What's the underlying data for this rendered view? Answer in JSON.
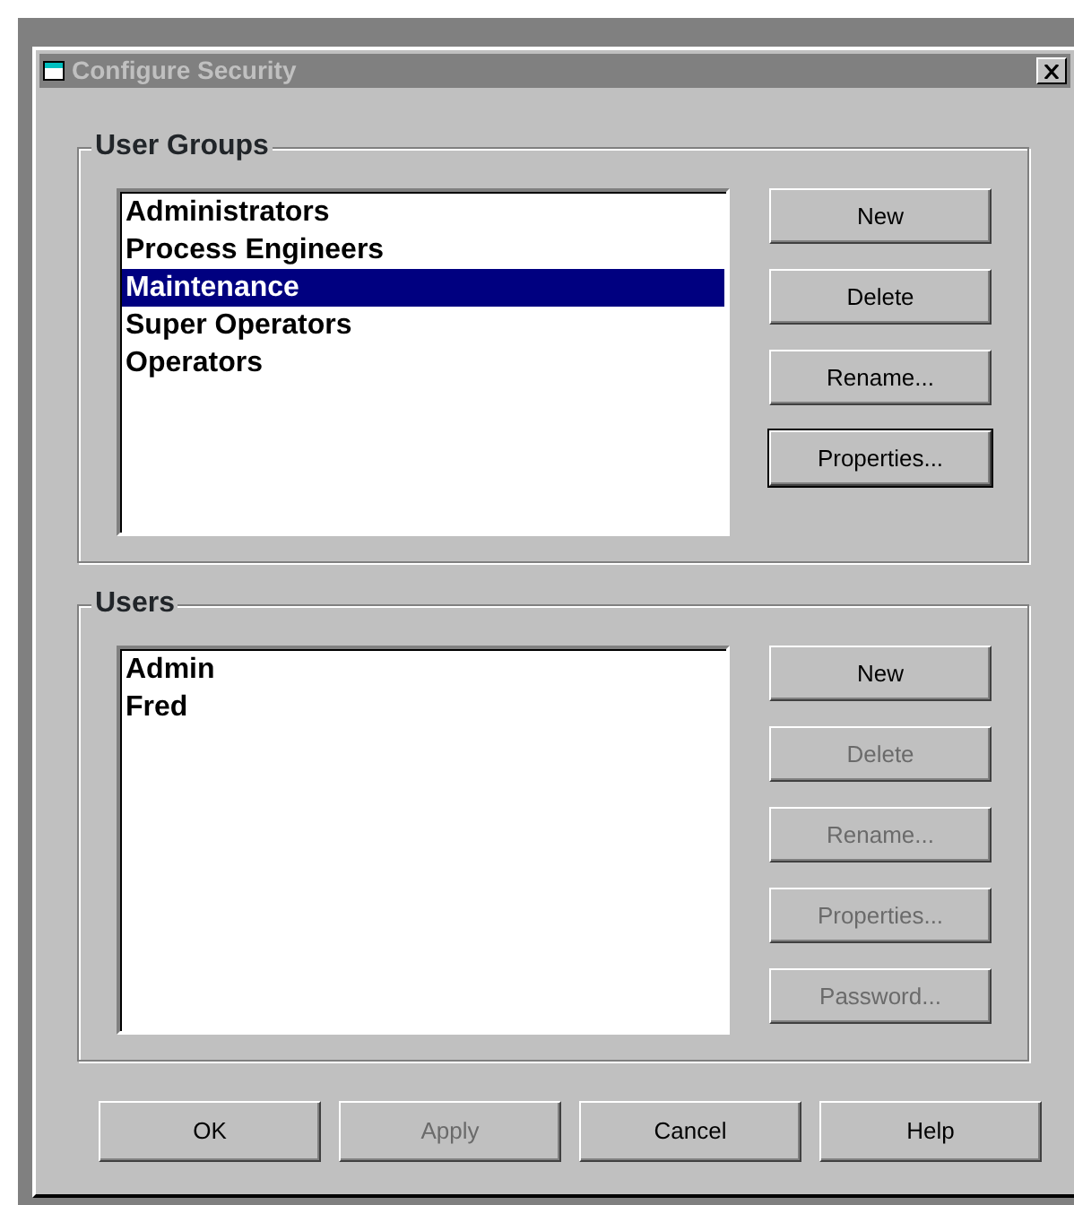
{
  "window": {
    "title": "Configure Security"
  },
  "groups": [
    {
      "title": "User Groups",
      "items": [
        {
          "label": "Administrators",
          "selected": false
        },
        {
          "label": "Process Engineers",
          "selected": false
        },
        {
          "label": "Maintenance",
          "selected": true
        },
        {
          "label": "Super Operators",
          "selected": false
        },
        {
          "label": "Operators",
          "selected": false
        }
      ],
      "buttons": [
        {
          "label": "New",
          "disabled": false,
          "focused": false
        },
        {
          "label": "Delete",
          "disabled": false,
          "focused": false
        },
        {
          "label": "Rename...",
          "disabled": false,
          "focused": false
        },
        {
          "label": "Properties...",
          "disabled": false,
          "focused": true
        }
      ]
    },
    {
      "title": "Users",
      "items": [
        {
          "label": "Admin",
          "selected": false
        },
        {
          "label": "Fred",
          "selected": false
        }
      ],
      "buttons": [
        {
          "label": "New",
          "disabled": false,
          "focused": false
        },
        {
          "label": "Delete",
          "disabled": true,
          "focused": false
        },
        {
          "label": "Rename...",
          "disabled": true,
          "focused": false
        },
        {
          "label": "Properties...",
          "disabled": true,
          "focused": false
        },
        {
          "label": "Password...",
          "disabled": true,
          "focused": false
        }
      ]
    }
  ],
  "footer_buttons": [
    {
      "label": "OK",
      "disabled": false
    },
    {
      "label": "Apply",
      "disabled": true
    },
    {
      "label": "Cancel",
      "disabled": false
    },
    {
      "label": "Help",
      "disabled": false
    }
  ]
}
